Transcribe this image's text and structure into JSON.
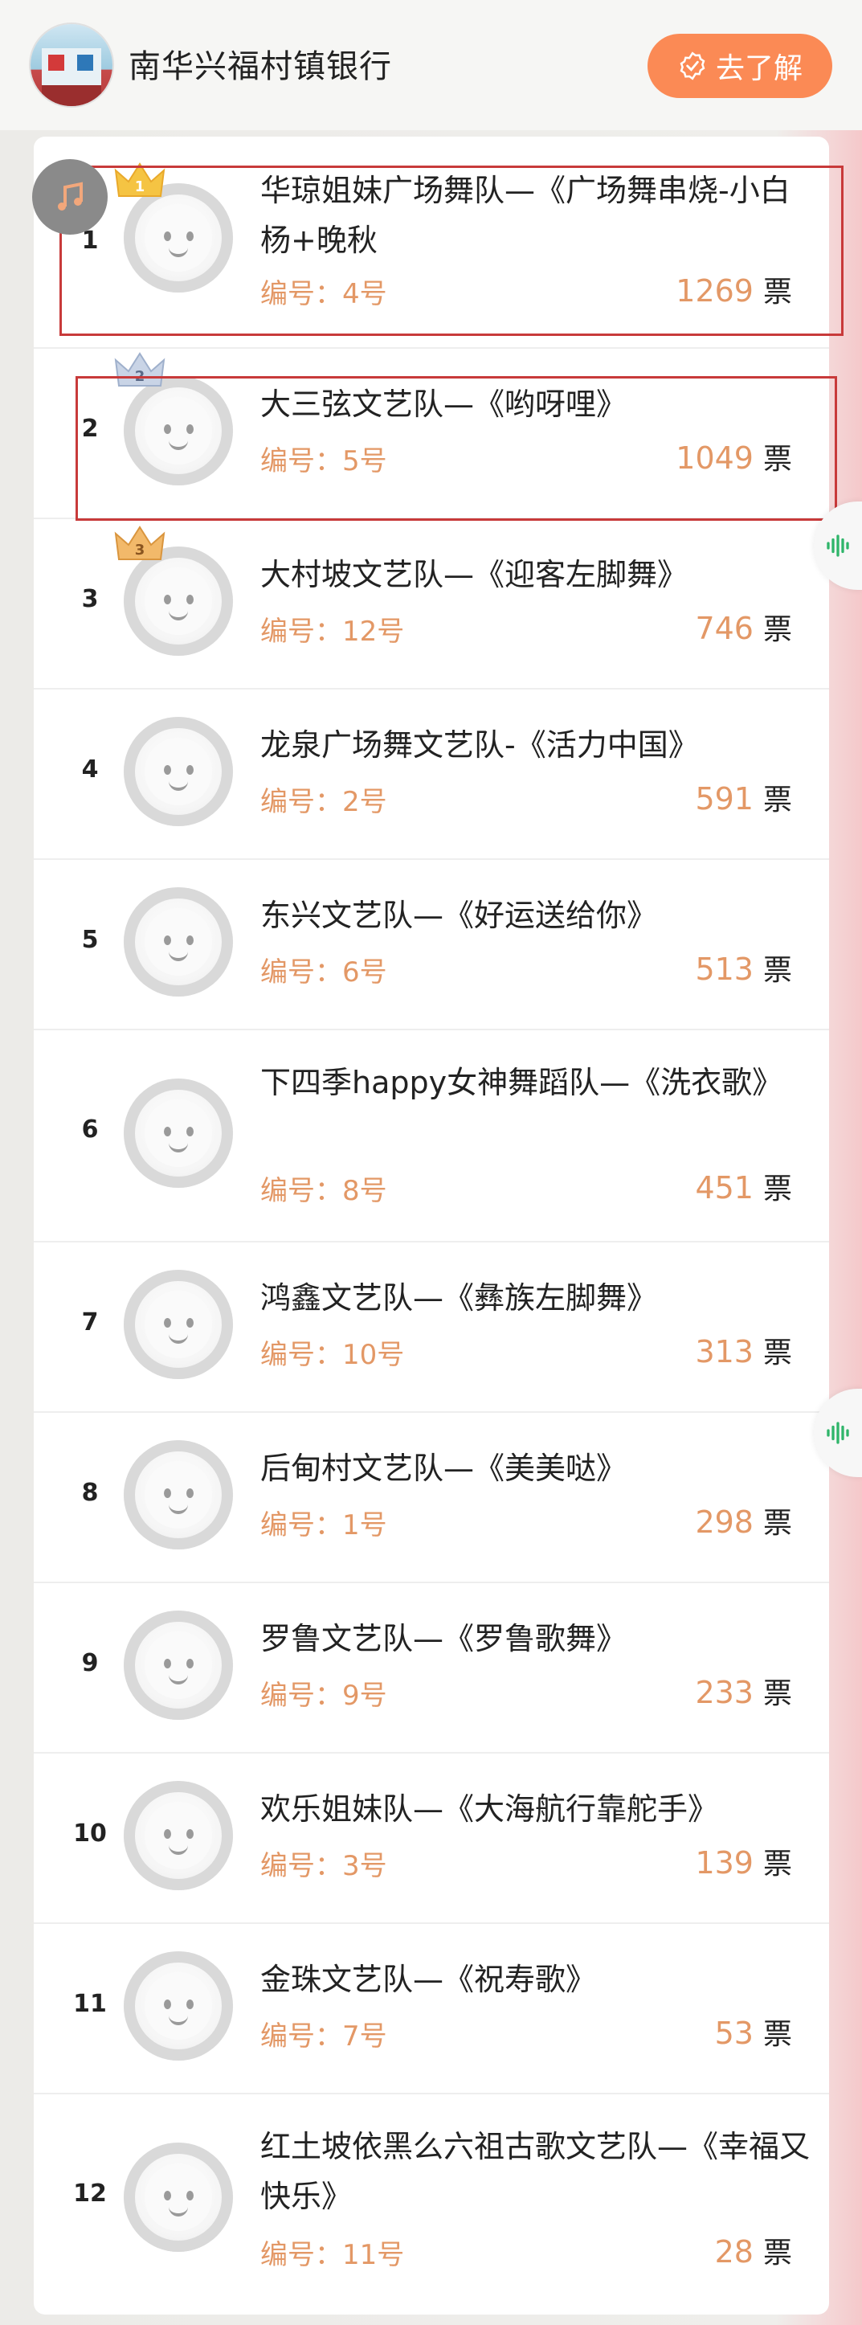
{
  "header": {
    "bank_name": "南华兴福村镇银行",
    "learn_button": "去了解"
  },
  "labels": {
    "number_prefix": "编号：",
    "vote_unit": "票"
  },
  "colors": {
    "accent": "#fb8a55",
    "vote_number": "#e39866",
    "highlight_border": "#c83a3a"
  },
  "entries": [
    {
      "rank": "1",
      "title": "华琼姐妹广场舞队—《广场舞串烧-小白杨+晚秋",
      "number": "4号",
      "votes": "1269",
      "crown": "1"
    },
    {
      "rank": "2",
      "title": "大三弦文艺队—《哟呀哩》",
      "number": "5号",
      "votes": "1049",
      "crown": "2"
    },
    {
      "rank": "3",
      "title": "大村坡文艺队—《迎客左脚舞》",
      "number": "12号",
      "votes": "746",
      "crown": "3"
    },
    {
      "rank": "4",
      "title": "龙泉广场舞文艺队-《活力中国》",
      "number": "2号",
      "votes": "591"
    },
    {
      "rank": "5",
      "title": "东兴文艺队—《好运送给你》",
      "number": "6号",
      "votes": "513"
    },
    {
      "rank": "6",
      "title": "下四季happy女神舞蹈队—《洗衣歌》",
      "number": "8号",
      "votes": "451"
    },
    {
      "rank": "7",
      "title": "鸿鑫文艺队—《彝族左脚舞》",
      "number": "10号",
      "votes": "313"
    },
    {
      "rank": "8",
      "title": "后甸村文艺队—《美美哒》",
      "number": "1号",
      "votes": "298"
    },
    {
      "rank": "9",
      "title": "罗鲁文艺队—《罗鲁歌舞》",
      "number": "9号",
      "votes": "233"
    },
    {
      "rank": "10",
      "title": "欢乐姐妹队—《大海航行靠舵手》",
      "number": "3号",
      "votes": "139"
    },
    {
      "rank": "11",
      "title": "金珠文艺队—《祝寿歌》",
      "number": "7号",
      "votes": "53"
    },
    {
      "rank": "12",
      "title": "红土坡依黑么六祖古歌文艺队—《幸福又快乐》",
      "number": "11号",
      "votes": "28"
    }
  ]
}
